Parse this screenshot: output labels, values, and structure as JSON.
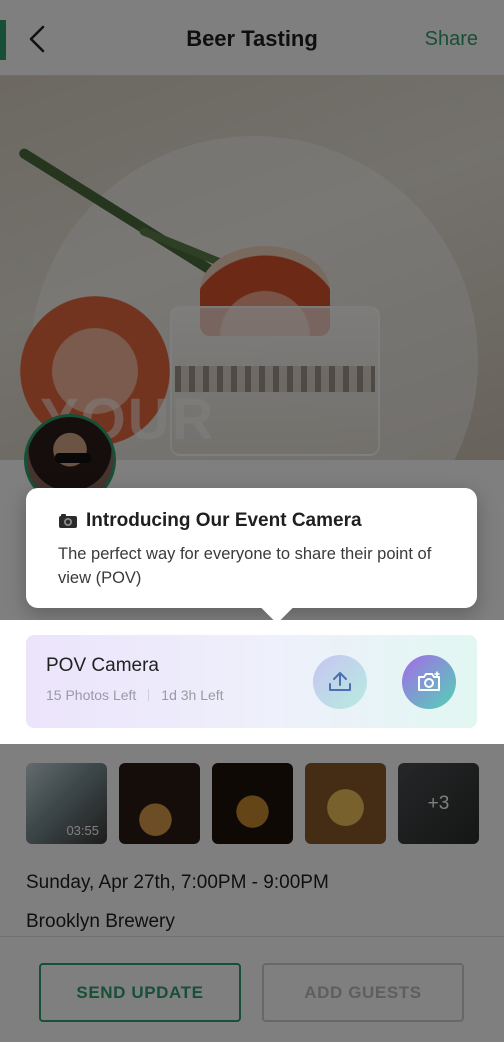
{
  "header": {
    "title": "Beer Tasting",
    "share_label": "Share"
  },
  "hero": {
    "overlay_text": "YOUR"
  },
  "tooltip": {
    "icon": "camera-emoji",
    "title": "Introducing Our Event Camera",
    "body": "The perfect way for everyone to share their point of view (POV)"
  },
  "pov_camera": {
    "title": "POV Camera",
    "photos_left": "15 Photos Left",
    "time_left": "1d 3h Left"
  },
  "thumbnails": [
    {
      "duration": "03:55"
    },
    {},
    {},
    {},
    {
      "more": "+3"
    }
  ],
  "event": {
    "date": "Sunday, Apr 27th, 7:00PM - 9:00PM",
    "place": "Brooklyn Brewery"
  },
  "actions": {
    "send_update": "SEND UPDATE",
    "add_guests": "ADD GUESTS"
  },
  "colors": {
    "accent": "#2e9e6e",
    "overlay": "rgba(0,0,0,0.5)"
  }
}
